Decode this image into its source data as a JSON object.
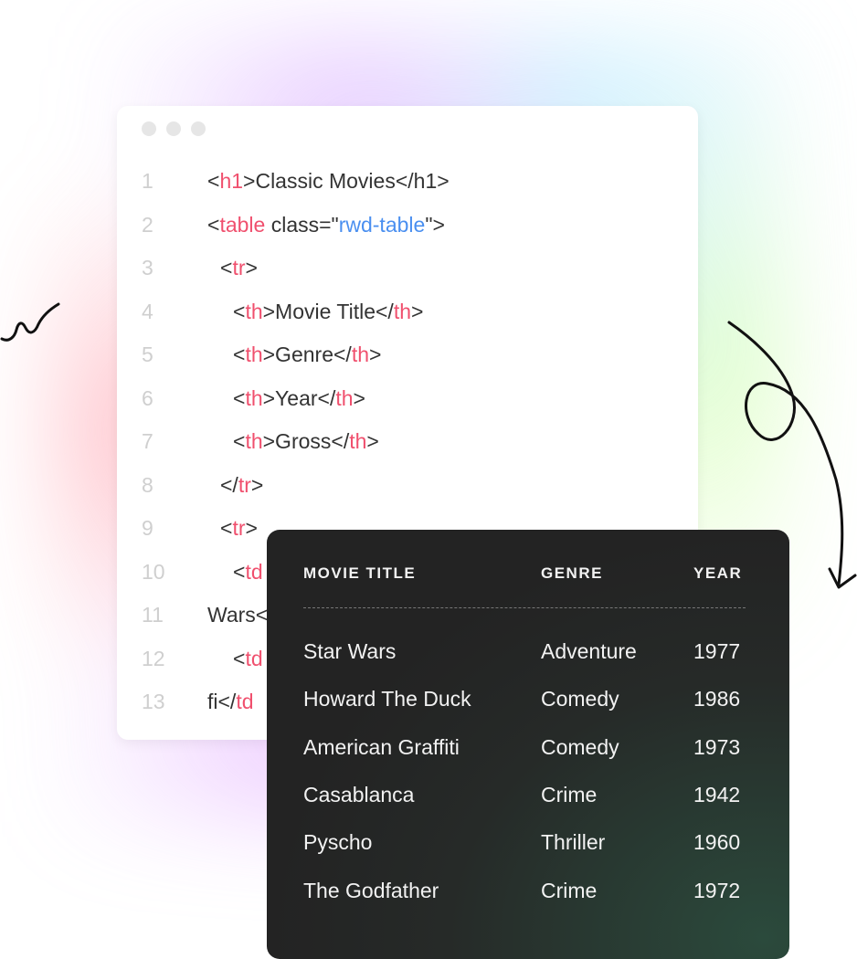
{
  "editor": {
    "lines": [
      {
        "n": "1",
        "indent": 0,
        "parts": [
          [
            "p",
            "<"
          ],
          [
            "t",
            "h1"
          ],
          [
            "p",
            ">Classic Movies</h1>"
          ]
        ]
      },
      {
        "n": "2",
        "indent": 0,
        "parts": [
          [
            "p",
            "<"
          ],
          [
            "t",
            "table"
          ],
          [
            "p",
            " class=\""
          ],
          [
            "s",
            "rwd-table"
          ],
          [
            "p",
            "\">"
          ]
        ]
      },
      {
        "n": "3",
        "indent": 1,
        "parts": [
          [
            "p",
            "<"
          ],
          [
            "t",
            "tr"
          ],
          [
            "p",
            ">"
          ]
        ]
      },
      {
        "n": "4",
        "indent": 2,
        "parts": [
          [
            "p",
            "<"
          ],
          [
            "t",
            "th"
          ],
          [
            "p",
            ">Movie Title</"
          ],
          [
            "t",
            "th"
          ],
          [
            "p",
            ">"
          ]
        ]
      },
      {
        "n": "5",
        "indent": 2,
        "parts": [
          [
            "p",
            "<"
          ],
          [
            "t",
            "th"
          ],
          [
            "p",
            ">Genre</"
          ],
          [
            "t",
            "th"
          ],
          [
            "p",
            ">"
          ]
        ]
      },
      {
        "n": "6",
        "indent": 2,
        "parts": [
          [
            "p",
            "<"
          ],
          [
            "t",
            "th"
          ],
          [
            "p",
            ">Year</"
          ],
          [
            "t",
            "th"
          ],
          [
            "p",
            ">"
          ]
        ]
      },
      {
        "n": "7",
        "indent": 2,
        "parts": [
          [
            "p",
            "<"
          ],
          [
            "t",
            "th"
          ],
          [
            "p",
            ">Gross</"
          ],
          [
            "t",
            "th"
          ],
          [
            "p",
            ">"
          ]
        ]
      },
      {
        "n": "8",
        "indent": 1,
        "parts": [
          [
            "p",
            "</"
          ],
          [
            "t",
            "tr"
          ],
          [
            "p",
            ">"
          ]
        ]
      },
      {
        "n": "9",
        "indent": 1,
        "parts": [
          [
            "p",
            "<"
          ],
          [
            "t",
            "tr"
          ],
          [
            "p",
            ">"
          ]
        ]
      },
      {
        "n": "10",
        "indent": 2,
        "parts": [
          [
            "p",
            "<"
          ],
          [
            "t",
            "td"
          ]
        ]
      },
      {
        "n": "11",
        "indent": 0,
        "parts": [
          [
            "p",
            "Wars<"
          ]
        ]
      },
      {
        "n": "12",
        "indent": 2,
        "parts": [
          [
            "p",
            "<"
          ],
          [
            "t",
            "td"
          ]
        ]
      },
      {
        "n": "13",
        "indent": 0,
        "parts": [
          [
            "p",
            "fi</"
          ],
          [
            "t",
            "td"
          ]
        ]
      }
    ]
  },
  "table": {
    "headers": [
      "MOVIE TITLE",
      "GENRE",
      "YEAR"
    ],
    "rows": [
      [
        "Star Wars",
        "Adventure",
        "1977"
      ],
      [
        "Howard The Duck",
        "Comedy",
        "1986"
      ],
      [
        "American Graffiti",
        "Comedy",
        "1973"
      ],
      [
        "Casablanca",
        "Crime",
        "1942"
      ],
      [
        "Pyscho",
        "Thriller",
        "1960"
      ],
      [
        "The Godfather",
        "Crime",
        "1972"
      ]
    ]
  },
  "colors": {
    "tag": "#f0506e",
    "string": "#4a8ff0",
    "card": "#232323"
  }
}
